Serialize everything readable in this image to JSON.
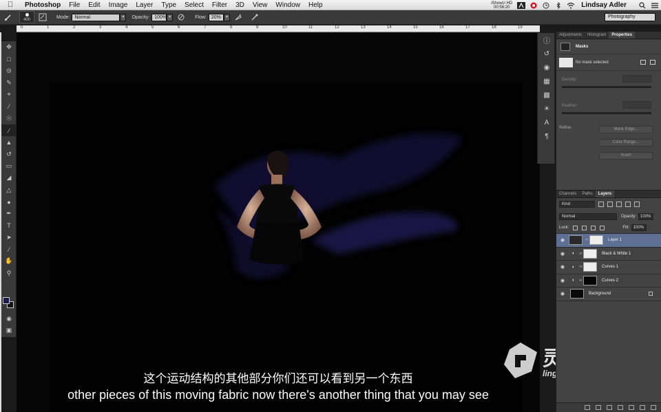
{
  "menubar": {
    "app": "Photoshop",
    "items": [
      "File",
      "Edit",
      "Image",
      "Layer",
      "Type",
      "Select",
      "Filter",
      "3D",
      "View",
      "Window",
      "Help"
    ],
    "recorder": "iShowU HD",
    "timer": "00:56:20",
    "user": "Lindsay Adler"
  },
  "options": {
    "brush_size": "400",
    "mode_label": "Mode:",
    "mode_value": "Normal",
    "opacity_label": "Opacity:",
    "opacity_value": "100%",
    "flow_label": "Flow:",
    "flow_value": "20%",
    "workspace": "Photography"
  },
  "ruler": {
    "ticks": [
      "0",
      "1",
      "2",
      "3",
      "4",
      "5",
      "6",
      "7",
      "8",
      "9",
      "10",
      "11",
      "12",
      "13",
      "14",
      "15",
      "16",
      "17",
      "18",
      "19"
    ]
  },
  "properties": {
    "tabs": [
      "Adjustments",
      "Histogram",
      "Properties"
    ],
    "active_tab": "Properties",
    "header": "Masks",
    "no_mask": "No mask selected",
    "density_label": "Density:",
    "feather_label": "Feather:",
    "refine_label": "Refine:",
    "mask_edge": "Mask Edge...",
    "color_range": "Color Range...",
    "invert": "Invert"
  },
  "layers_panel": {
    "tabs": [
      "Channels",
      "Paths",
      "Layers"
    ],
    "active_tab": "Layers",
    "kind": "Kind",
    "blend": "Normal",
    "opacity_label": "Opacity:",
    "opacity_value": "100%",
    "lock_label": "Lock:",
    "fill_label": "Fill:",
    "fill_value": "100%",
    "layers": [
      {
        "name": "Layer 1",
        "selected": true
      },
      {
        "name": "Black & White 1",
        "selected": false
      },
      {
        "name": "Curves 1",
        "selected": false
      },
      {
        "name": "Curves 2",
        "selected": false
      },
      {
        "name": "Background",
        "selected": false
      }
    ]
  },
  "subtitles": {
    "cn": "这个运动结构的其他部分你们还可以看到另一个东西",
    "en": "other pieces of this moving fabric now there's another thing that you may see"
  },
  "watermark": {
    "cn": "灵感中国",
    "url": "lingganchina.com"
  },
  "colors": {
    "foreground": "#1c1a4a",
    "background": "#111111",
    "selected_layer": "#5d6f93"
  }
}
